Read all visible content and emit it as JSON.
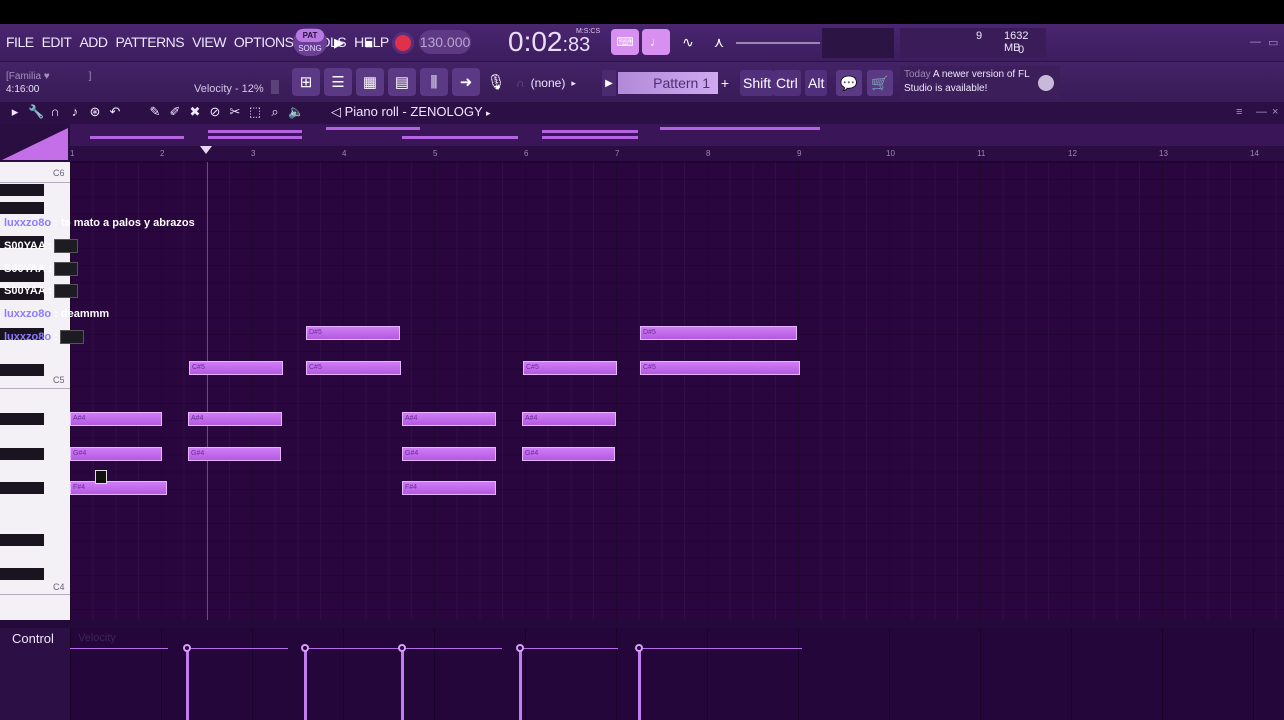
{
  "menu": [
    "FILE",
    "EDIT",
    "ADD",
    "PATTERNS",
    "VIEW",
    "OPTIONS",
    "TOOLS",
    "HELP"
  ],
  "transport": {
    "pat_label": "PAT",
    "song_label": "SONG",
    "tempo": "130.000",
    "time_main": "0:02",
    "time_sub": ":83",
    "time_unit": "M:S:CS"
  },
  "cpu": {
    "polyphony": "9",
    "memory": "1632 MB",
    "cpu_val": "0"
  },
  "hint": {
    "preset": "[Familia ♥",
    "bracket": "]",
    "time": "4:16:00",
    "velocity": "Velocity - 12%"
  },
  "pattern": {
    "none": "(none)",
    "name": "Pattern 1"
  },
  "modkeys": [
    "Shift",
    "Ctrl",
    "Alt"
  ],
  "news": {
    "today": "Today",
    "message": "A newer version of FL Studio is available!"
  },
  "piano_roll": {
    "title": "Piano roll - ZENOLOGY"
  },
  "ruler": [
    "1",
    "2",
    "3",
    "4",
    "5",
    "6",
    "7",
    "8",
    "9",
    "10",
    "11",
    "12",
    "13",
    "14"
  ],
  "key_labels": [
    "C6",
    "C5",
    "C4"
  ],
  "notes": [
    {
      "label": "D#5"
    },
    {
      "label": "D#5"
    },
    {
      "label": "C#5"
    },
    {
      "label": "C#5"
    },
    {
      "label": "C#5"
    },
    {
      "label": "C#5"
    },
    {
      "label": "A#4"
    },
    {
      "label": "A#4"
    },
    {
      "label": "A#4"
    },
    {
      "label": "A#4"
    },
    {
      "label": "G#4"
    },
    {
      "label": "G#4"
    },
    {
      "label": "G#4"
    },
    {
      "label": "G#4"
    },
    {
      "label": "F#4"
    },
    {
      "label": "F#4"
    }
  ],
  "chat": [
    {
      "user": "luxxzo8o",
      "sep": ":",
      "msg": "te mato a palos y abrazos"
    },
    {
      "user": "S00YAA",
      "sep": ":",
      "msg": ""
    },
    {
      "user": "S00YAA",
      "sep": ":",
      "msg": ""
    },
    {
      "user": "S00YAA",
      "sep": ":",
      "msg": ""
    },
    {
      "user": "luxxzo8o",
      "sep": ":",
      "msg": "deammm"
    },
    {
      "user": "luxxzo8o",
      "sep": ":",
      "msg": ""
    }
  ],
  "control": {
    "label": "Control",
    "param": "Velocity"
  },
  "colors": {
    "accent": "#c46fe8",
    "note": "#b25ae2",
    "background": "#2a063f"
  }
}
